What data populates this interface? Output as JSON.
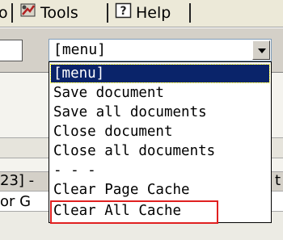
{
  "menubar": {
    "partial_prev": "o",
    "tools_label": "Tools",
    "help_label": "Help"
  },
  "toolbar": {
    "select_value": "[menu]"
  },
  "dropdown": {
    "items": [
      {
        "label": "[menu]",
        "selected": true
      },
      {
        "label": "Save document"
      },
      {
        "label": "Save all documents"
      },
      {
        "label": "Close document"
      },
      {
        "label": "Close all documents"
      },
      {
        "label": "- - -"
      },
      {
        "label": "Clear Page Cache"
      },
      {
        "label": "Clear All Cache",
        "annotated": true
      }
    ]
  },
  "background": {
    "left_text": "23] -",
    "right_text": "t",
    "bottom_left": "or G"
  },
  "colors": {
    "selection": "#0a246a",
    "annotation": "#e02020"
  }
}
